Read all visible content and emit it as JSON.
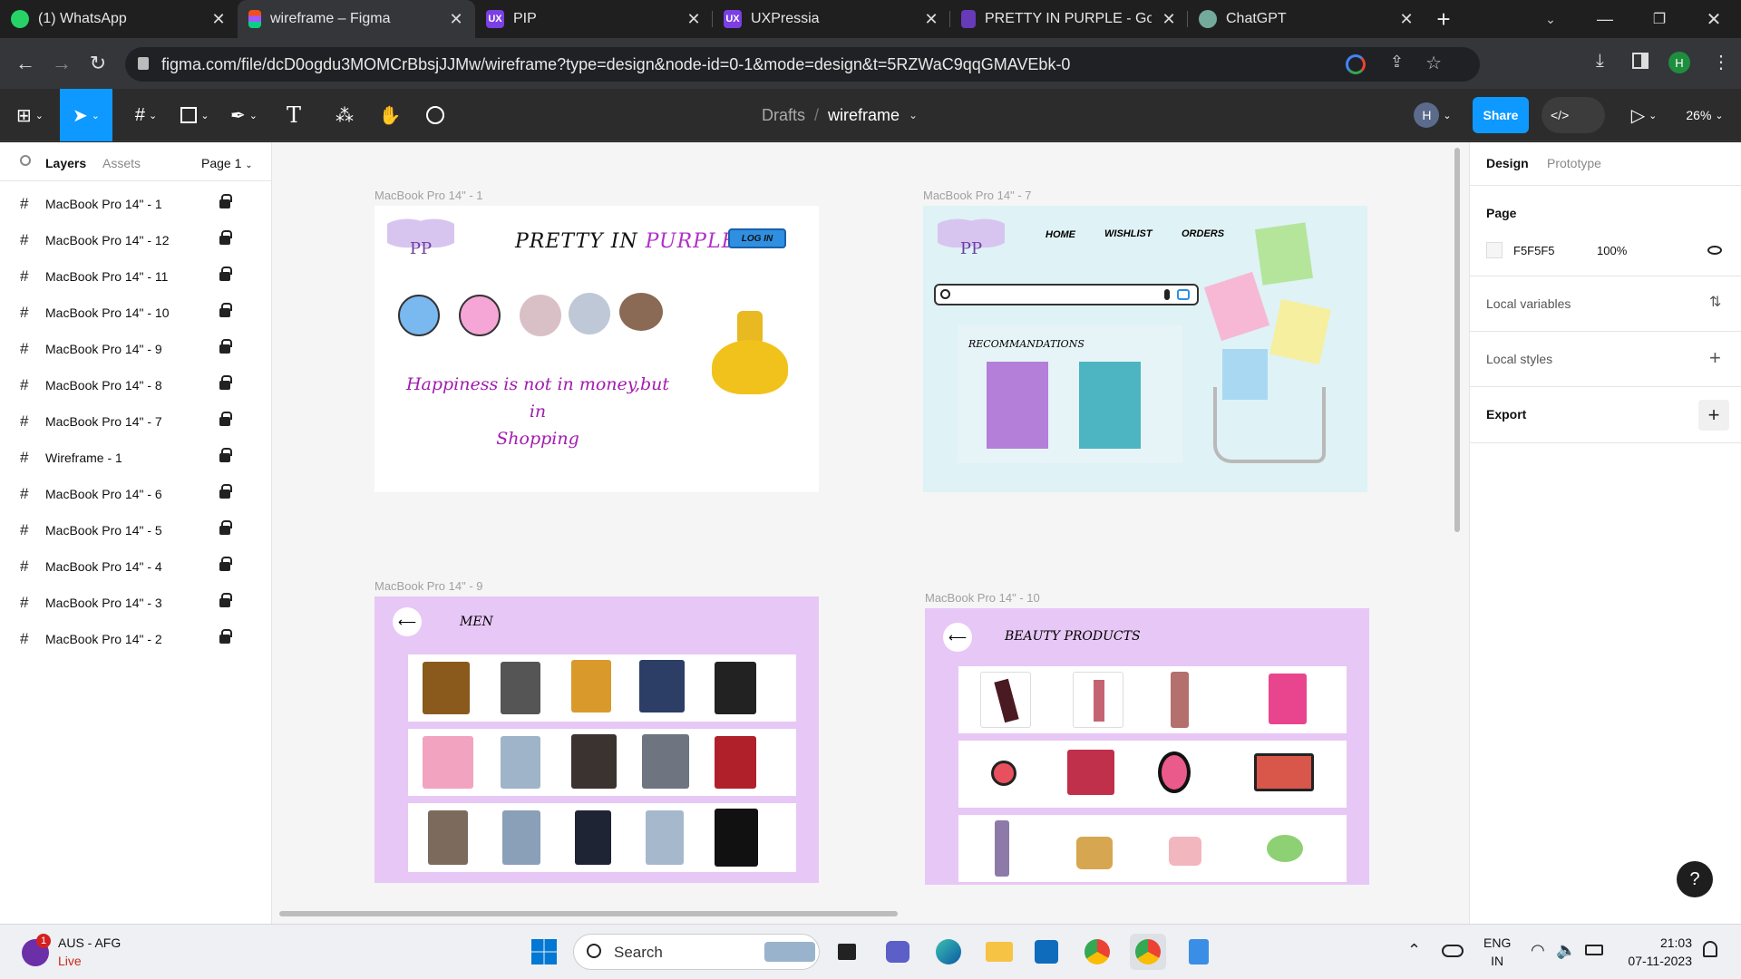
{
  "browser": {
    "tabs": [
      {
        "label": "(1) WhatsApp",
        "icon": "whatsapp-icon",
        "color": "#25d366"
      },
      {
        "label": "wireframe – Figma",
        "icon": "figma-icon",
        "color": "#a259ff"
      },
      {
        "label": "PIP",
        "icon": "uxpressia-icon",
        "color": "#7b3fe4"
      },
      {
        "label": "UXPressia",
        "icon": "uxpressia-icon",
        "color": "#7b3fe4"
      },
      {
        "label": "PRETTY IN PURPLE - Goog",
        "icon": "google-forms-icon",
        "color": "#673ab7"
      },
      {
        "label": "ChatGPT",
        "icon": "chatgpt-icon",
        "color": "#74aa9c"
      }
    ],
    "url": "figma.com/file/dcD0ogdu3MOMCrBbsjJJMw/wireframe?type=design&node-id=0-1&mode=design&t=5RZWaC9qqGMAVEbk-0",
    "profile_initial": "H"
  },
  "figma": {
    "breadcrumb_drafts": "Drafts",
    "breadcrumb_sep": "/",
    "file_name": "wireframe",
    "avatar_initial": "H",
    "share_label": "Share",
    "zoom": "26%",
    "accent": "#0d99ff"
  },
  "left_panel": {
    "tab_layers": "Layers",
    "tab_assets": "Assets",
    "page_selector": "Page 1",
    "layers": [
      "MacBook Pro 14\" - 1",
      "MacBook Pro 14\" - 12",
      "MacBook Pro 14\" - 11",
      "MacBook Pro 14\" - 10",
      "MacBook Pro 14\" - 9",
      "MacBook Pro 14\" - 8",
      "MacBook Pro 14\" - 7",
      "Wireframe - 1",
      "MacBook Pro 14\" - 6",
      "MacBook Pro 14\" - 5",
      "MacBook Pro 14\" - 4",
      "MacBook Pro 14\" - 3",
      "MacBook Pro 14\" - 2"
    ]
  },
  "canvas": {
    "frame1": {
      "label": "MacBook Pro 14\" - 1",
      "logo": "PP",
      "title_a": "PRETTY IN ",
      "title_b": "PURPLE",
      "login": "LOG IN",
      "tagline_1": "Happiness is not in money,but in",
      "tagline_2": "Shopping"
    },
    "frame7": {
      "label": "MacBook Pro 14\" - 7",
      "logo": "PP",
      "nav": [
        "HOME",
        "WISHLIST",
        "ORDERS"
      ],
      "recs_title": "RECOMMANDATIONS"
    },
    "frame9": {
      "label": "MacBook Pro 14\" - 9",
      "title": "MEN",
      "back": "⟵"
    },
    "frame10": {
      "label": "MacBook Pro 14\" - 10",
      "title": "BEAUTY PRODUCTS",
      "back": "⟵"
    }
  },
  "right_panel": {
    "tab_design": "Design",
    "tab_prototype": "Prototype",
    "page_heading": "Page",
    "page_color": "F5F5F5",
    "page_opacity": "100%",
    "local_variables": "Local variables",
    "local_styles": "Local styles",
    "export": "Export",
    "help": "?"
  },
  "taskbar": {
    "weather_title": "AUS - AFG",
    "weather_sub": "Live",
    "badge": "1",
    "search": "Search",
    "lang_1": "ENG",
    "lang_2": "IN",
    "time": "21:03",
    "date": "07-11-2023"
  }
}
